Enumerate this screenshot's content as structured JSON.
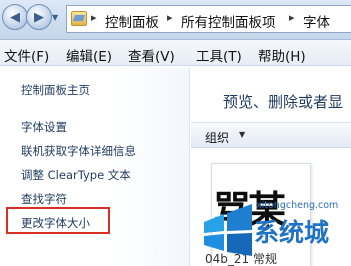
{
  "address_bar": {
    "separators": [
      "▸",
      "▸",
      "▸"
    ],
    "segments": [
      "控制面板",
      "所有控制面板项",
      "字体"
    ]
  },
  "menu": [
    "文件(F)",
    "编辑(E)",
    "查看(V)",
    "工具(T)",
    "帮助(H)"
  ],
  "left_pane": {
    "links": [
      "控制面板主页",
      "字体设置",
      "联机获取字体详细信息",
      "调整 ClearType 文本",
      "查找字符",
      "更改字体大小"
    ],
    "highlighted": "更改字体大小"
  },
  "right_pane": {
    "title": "预览、删除或者显",
    "toolbar_organize": "组织",
    "font_preview_glyphs": "骂某",
    "file_name": "04b_21 常规"
  },
  "watermark": {
    "url": "xitongcheng.com",
    "brand": "系统城"
  },
  "colors": {
    "link_text": "#1e3a5f",
    "highlight_border": "#d93025",
    "watermark_blue": "#1f72c4"
  },
  "icons": [
    "back-arrow-icon",
    "forward-arrow-icon",
    "dropdown-arrow-icon",
    "folder-icon",
    "breadcrumb-chevron-icon",
    "windows-logo-icon"
  ]
}
